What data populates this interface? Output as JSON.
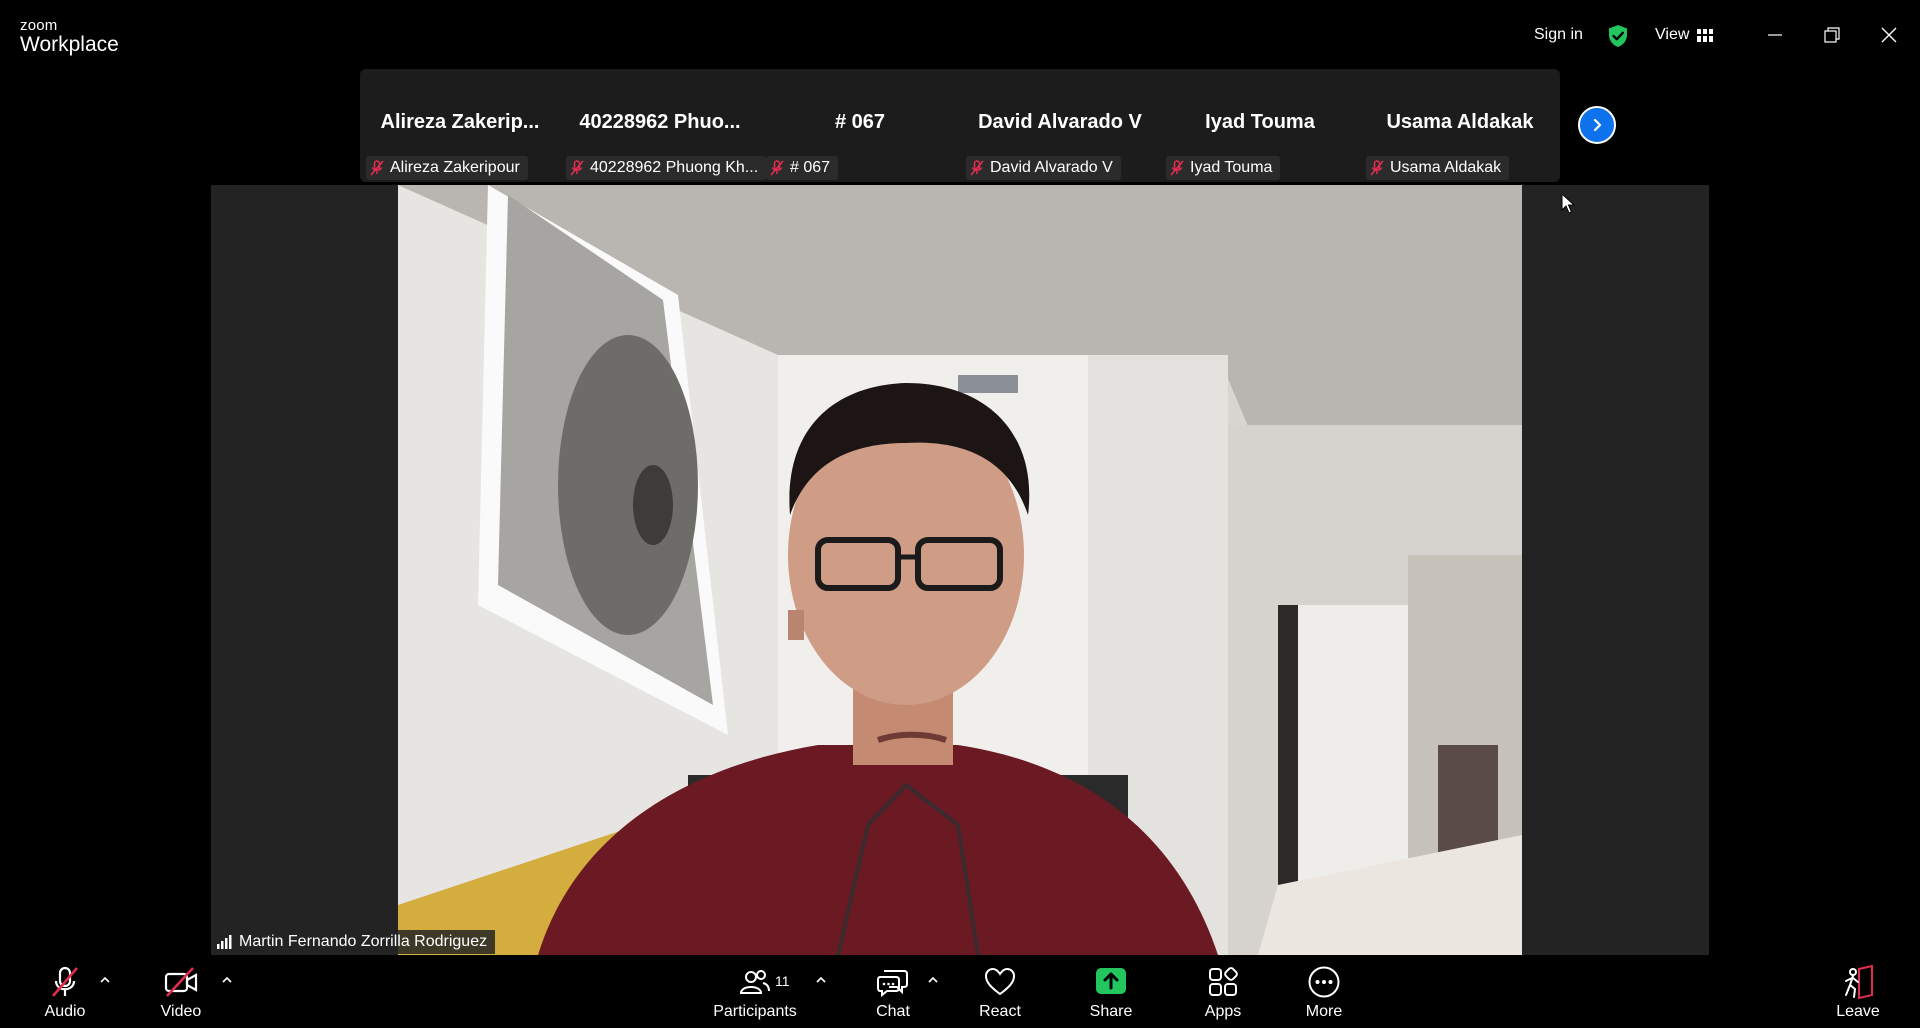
{
  "app": {
    "logo_top": "zoom",
    "logo_bottom": "Workplace"
  },
  "titlebar": {
    "sign_in": "Sign in",
    "view_label": "View",
    "security_color": "#22c55e",
    "icons": [
      "minimize-icon",
      "restore-icon",
      "close-icon"
    ]
  },
  "strip": {
    "tiles": [
      {
        "name": "Alireza  Zakerip...",
        "chip": "Alireza Zakeripour",
        "muted": true
      },
      {
        "name": "40228962  Phuo...",
        "chip": "40228962 Phuong Kh...",
        "muted": true
      },
      {
        "name": "# 067",
        "chip": "# 067",
        "muted": true
      },
      {
        "name": "David Alvarado V",
        "chip": "David Alvarado V",
        "muted": true
      },
      {
        "name": "Iyad Touma",
        "chip": "Iyad Touma",
        "muted": true
      },
      {
        "name": "Usama Aldakak",
        "chip": "Usama Aldakak",
        "muted": true
      }
    ],
    "next_icon": "chevron-right-icon",
    "accent": "#0e72ed"
  },
  "speaker": {
    "name": "Martin Fernando Zorrilla Rodriguez"
  },
  "toolbar": {
    "audio": "Audio",
    "video": "Video",
    "participants": "Participants",
    "participants_count": "11",
    "chat": "Chat",
    "react": "React",
    "share": "Share",
    "apps": "Apps",
    "more": "More",
    "leave": "Leave",
    "share_color": "#22c55e",
    "mute_color": "#e02d50"
  }
}
